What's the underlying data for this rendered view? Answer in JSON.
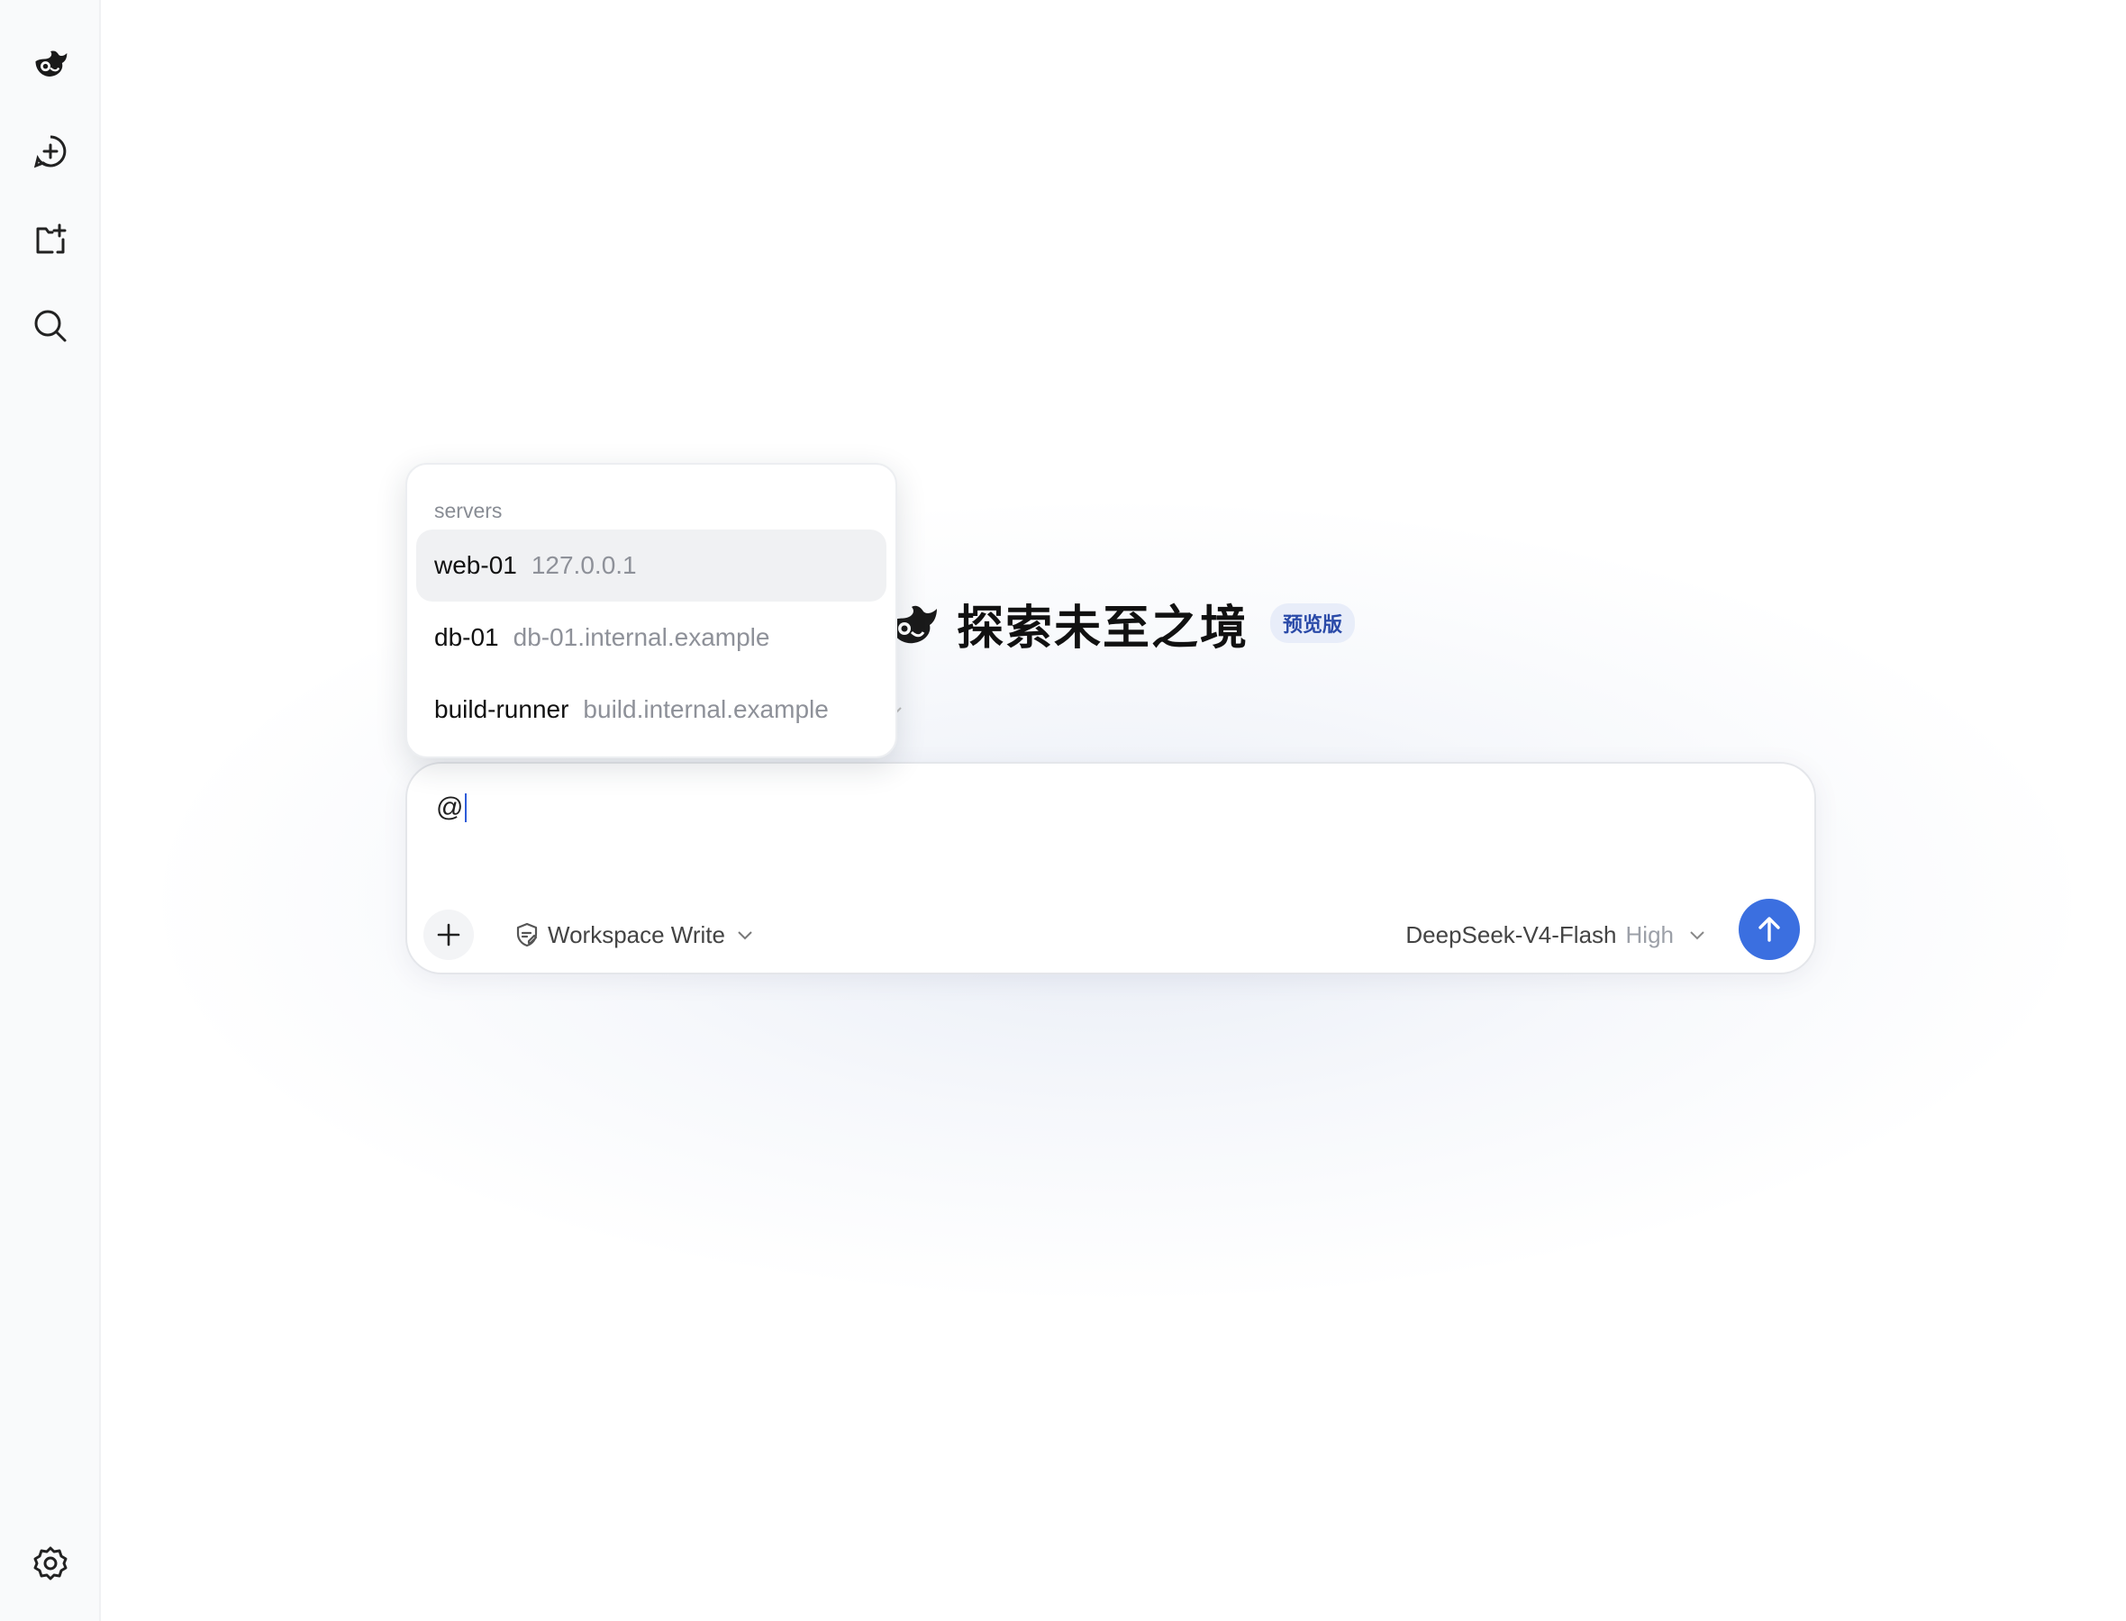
{
  "sidebar": {
    "items": [
      {
        "name": "logo",
        "icon": "whale-logo-icon"
      },
      {
        "name": "new-chat",
        "icon": "plus-circle-icon"
      },
      {
        "name": "new-project",
        "icon": "folder-plus-icon"
      },
      {
        "name": "search",
        "icon": "search-icon"
      },
      {
        "name": "settings",
        "icon": "gear-icon"
      }
    ]
  },
  "hero": {
    "title": "探索未至之境",
    "badge": "预览版"
  },
  "popup": {
    "header": "servers",
    "items": [
      {
        "name": "web-01",
        "host": "127.0.0.1",
        "active": true
      },
      {
        "name": "db-01",
        "host": "db-01.internal.example",
        "active": false
      },
      {
        "name": "build-runner",
        "host": "build.internal.example",
        "active": false
      }
    ]
  },
  "composer": {
    "value": "@",
    "mode_label": "Workspace Write",
    "model_name": "DeepSeek-V4-Flash",
    "model_level": "High"
  },
  "colors": {
    "accent": "#3b6fe0",
    "badge_bg": "#e8edf9",
    "badge_text": "#2a4aa8"
  }
}
